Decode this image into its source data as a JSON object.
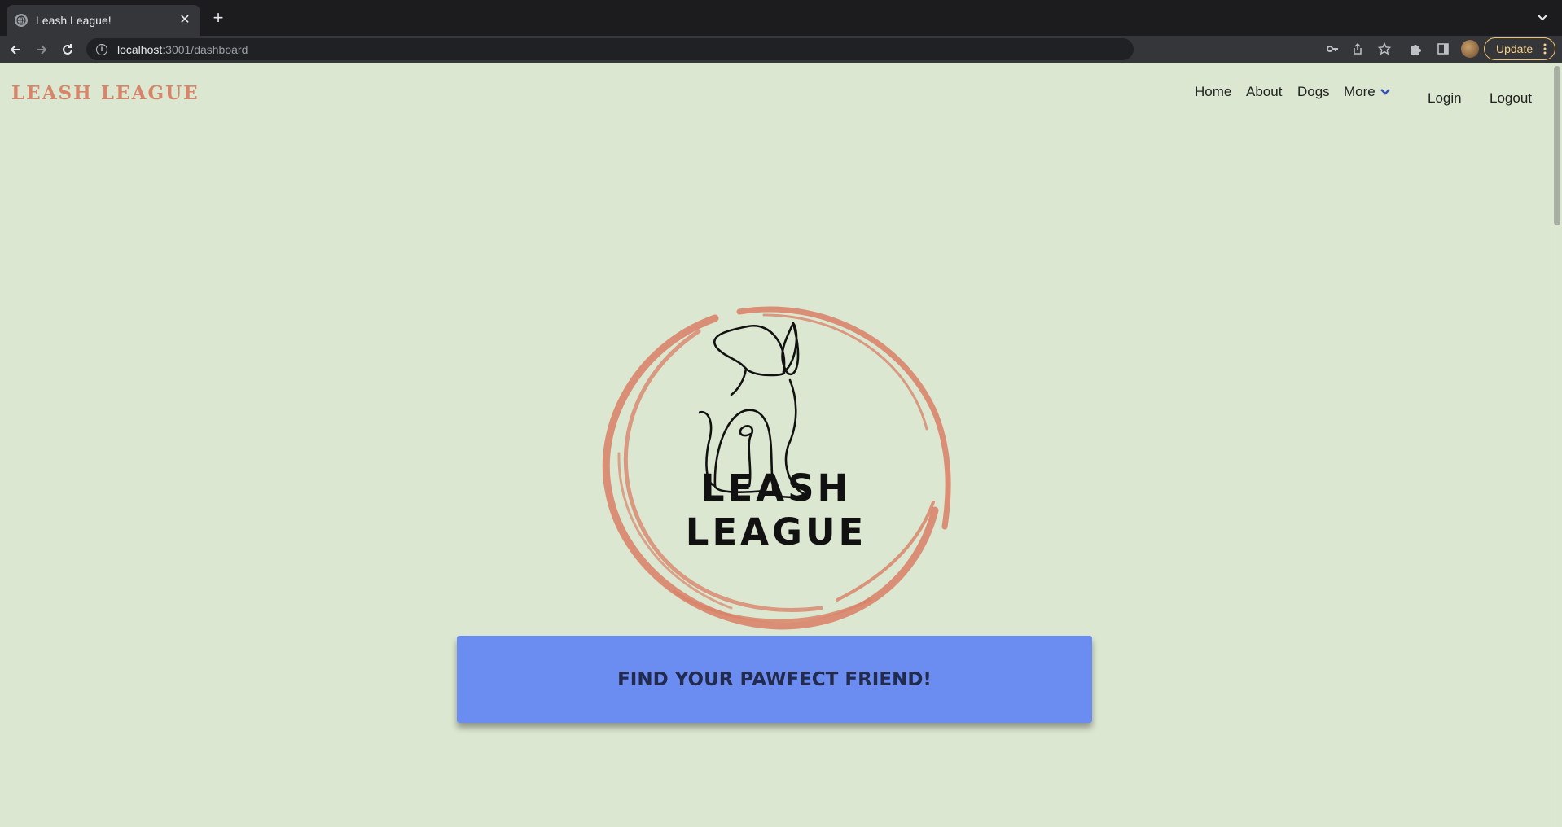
{
  "browser": {
    "tab_title": "Leash League!",
    "url_host": "localhost",
    "url_path": ":3001/dashboard",
    "update_label": "Update"
  },
  "header": {
    "brand": "LEASH LEAGUE",
    "nav": {
      "home": "Home",
      "about": "About",
      "dogs": "Dogs",
      "more": "More",
      "login": "Login",
      "logout": "Logout"
    }
  },
  "hero": {
    "logo_line1": "LEASH",
    "logo_line2": "LEAGUE"
  },
  "cta": {
    "label": "FIND YOUR PAWFECT FRIEND!"
  },
  "colors": {
    "background": "#dbe7d0",
    "brand": "#d8846a",
    "cta": "#6b8df2"
  }
}
